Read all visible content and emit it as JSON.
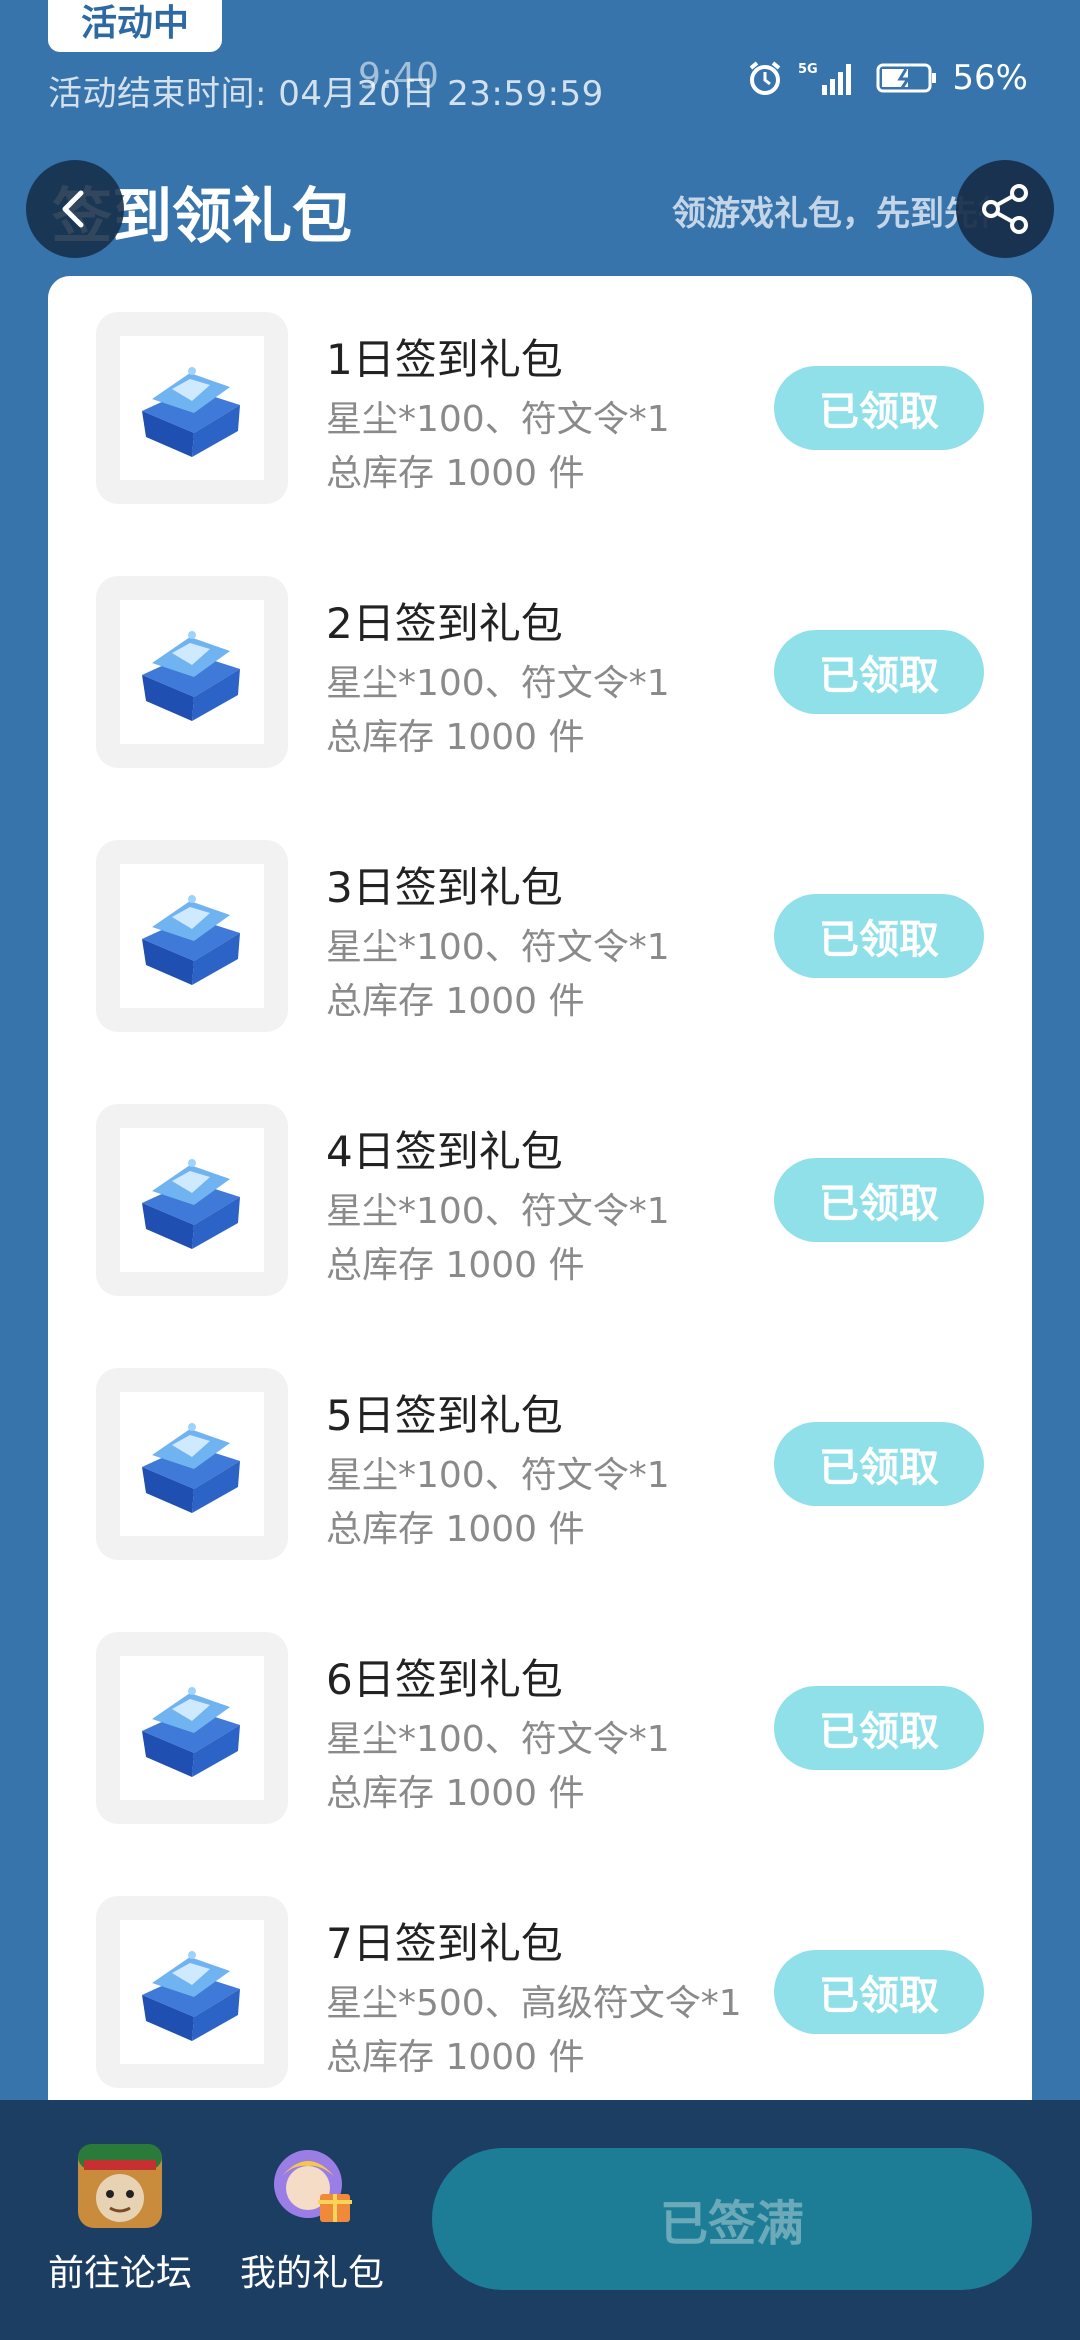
{
  "status_bar": {
    "time": "9:40",
    "network": "5G",
    "battery": "56%"
  },
  "header": {
    "activity_badge": "活动中",
    "end_time": "活动结束时间: 04月20日 23:59:59",
    "title": "签到领礼包",
    "subtitle": "领游戏礼包，先到先得"
  },
  "gifts": [
    {
      "title": "1日签到礼包",
      "desc": "星尘*100、符文令*1",
      "stock": "总库存 1000 件",
      "button": "已领取"
    },
    {
      "title": "2日签到礼包",
      "desc": "星尘*100、符文令*1",
      "stock": "总库存 1000 件",
      "button": "已领取"
    },
    {
      "title": "3日签到礼包",
      "desc": "星尘*100、符文令*1",
      "stock": "总库存 1000 件",
      "button": "已领取"
    },
    {
      "title": "4日签到礼包",
      "desc": "星尘*100、符文令*1",
      "stock": "总库存 1000 件",
      "button": "已领取"
    },
    {
      "title": "5日签到礼包",
      "desc": "星尘*100、符文令*1",
      "stock": "总库存 1000 件",
      "button": "已领取"
    },
    {
      "title": "6日签到礼包",
      "desc": "星尘*100、符文令*1",
      "stock": "总库存 1000 件",
      "button": "已领取"
    },
    {
      "title": "7日签到礼包",
      "desc": "星尘*500、高级符文令*1",
      "stock": "总库存 1000 件",
      "button": "已领取"
    }
  ],
  "bottom_bar": {
    "forum_label": "前往论坛",
    "my_gifts_label": "我的礼包",
    "signed_button": "已签满"
  },
  "colors": {
    "background": "#3774ab",
    "claimed_button": "#8fe0e8",
    "bottom_bar": "#1d3e63",
    "signed_button": "#1e7d96"
  }
}
